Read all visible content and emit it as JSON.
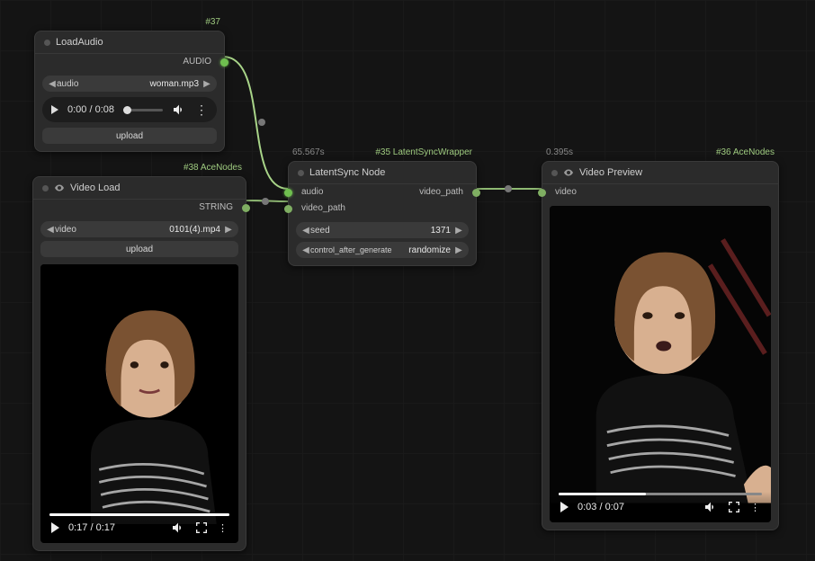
{
  "nodes": {
    "loadAudio": {
      "id_tag": "#37",
      "title": "LoadAudio",
      "output_label": "AUDIO",
      "audio_param": "audio",
      "audio_value": "woman.mp3",
      "time": "0:00 / 0:08",
      "upload": "upload"
    },
    "videoLoad": {
      "id_tag": "#38 AceNodes",
      "title": "Video Load",
      "output_label": "STRING",
      "video_param": "video",
      "video_value": "0101(4).mp4",
      "upload": "upload",
      "time": "0:17 / 0:17",
      "progress": 100
    },
    "latent": {
      "id_tag": "#35 LatentSyncWrapper",
      "time_tag": "65.567s",
      "title": "LatentSync Node",
      "in_audio": "audio",
      "in_video_path": "video_path",
      "out_video_path": "video_path",
      "seed_param": "seed",
      "seed_value": "1371",
      "cag_param": "control_after_generate",
      "cag_value": "randomize"
    },
    "videoPreview": {
      "id_tag": "#36 AceNodes",
      "time_tag": "0.395s",
      "title": "Video Preview",
      "in_video": "video",
      "time": "0:03 / 0:07",
      "progress": 43
    }
  }
}
